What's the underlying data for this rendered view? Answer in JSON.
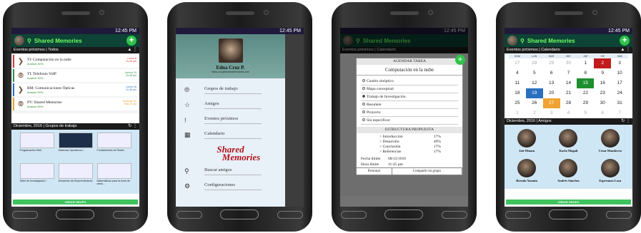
{
  "status_time": "12:45 PM",
  "app": {
    "name": "Shared Memories",
    "fab": "+"
  },
  "events": {
    "header": "Eventos próximos | Todos",
    "header_cal": "Eventos próximos | Calendario",
    "items": [
      {
        "title": "TI: Computación en la nube",
        "progress": "Avance 30%",
        "date": "Lunes 8\n11:45 pm",
        "color": "#d23b3b"
      },
      {
        "title": "TI: Telefonía VoIP",
        "progress": "Avance 50%",
        "date": "Jueves 15\n10:45 am",
        "color": "#2e8f4e"
      },
      {
        "title": "RM: Comunicaciones Ópticas",
        "progress": "Avance 50%",
        "date": "Lunes 15\n11:45 pm",
        "color": "#2a6fbf"
      },
      {
        "title": "PY: Shared Memories",
        "progress": "Avance 80%",
        "date": "Domingo 31\nTodo el día",
        "color": "#e8a22a"
      }
    ]
  },
  "groups": {
    "header": "Diciembre, 2016 | Grupos de trabajo",
    "tiles": [
      "Programación Web",
      "Sistemas Operativos I",
      "Fundamentos de Redes",
      "Taller de Investigación I",
      "Desarrollo de Emprendedores",
      "Matemáticas para la toma de decis..."
    ],
    "create_button": "CREAR GRUPO"
  },
  "drawer": {
    "name": "Edna Cruz P.",
    "email": "edna.cruz@sharedmemories.com",
    "menu": [
      "Grupos de trabajo",
      "Amigos",
      "Eventos próximos",
      "Calendario"
    ],
    "logo_line1": "Shared",
    "logo_line2": "Memories",
    "menu2": [
      "Buscar amigos",
      "Configuraciones"
    ]
  },
  "dialog": {
    "title": "AGENDAR TAREA",
    "subject": "Computación en la nube",
    "options": [
      "Cuadro sinóptico",
      "Mapa conceptual",
      "Trabajo de Investigación",
      "Resumen",
      "Proyecto",
      "Sin especificar"
    ],
    "structure_title": "ESTRUCTURA PROPUESTA",
    "structure": [
      {
        "name": "Introducción",
        "pct": "17%"
      },
      {
        "name": "Desarrollo",
        "pct": "49%"
      },
      {
        "name": "Conclusión",
        "pct": "17%"
      },
      {
        "name": "Referencias",
        "pct": "17%"
      }
    ],
    "deadline_label": "Fecha límite",
    "deadline": "08/12/1016",
    "time_label": "Hora límite",
    "time": "11:45 pm",
    "tab_personal": "Personal",
    "tab_group": "Compartir en grupo"
  },
  "calendar": {
    "weekdays": [
      "DOM",
      "LUN",
      "MAR",
      "MIE",
      "JUE",
      "VIE",
      "SAB"
    ],
    "cells": [
      "27",
      "28",
      "29",
      "30",
      "1",
      "2",
      "3",
      "4",
      "5",
      "6",
      "7",
      "8",
      "9",
      "10",
      "11",
      "12",
      "13",
      "14",
      "15",
      "16",
      "17",
      "18",
      "19",
      "20",
      "21",
      "22",
      "23",
      "24",
      "25",
      "26",
      "27",
      "28",
      "29",
      "30",
      "31",
      "1",
      "2",
      "3",
      "4",
      "5",
      "6",
      "7"
    ]
  },
  "friends": {
    "header": "Diciembre, 2016 | Amigos",
    "list": [
      "Jair Hinam",
      "Karla Magali",
      "César Humberto",
      "Brenda Yazmín",
      "Andrés Sánchez",
      "Esperanza Loza"
    ],
    "create_button": "CREAR GRUPO"
  }
}
